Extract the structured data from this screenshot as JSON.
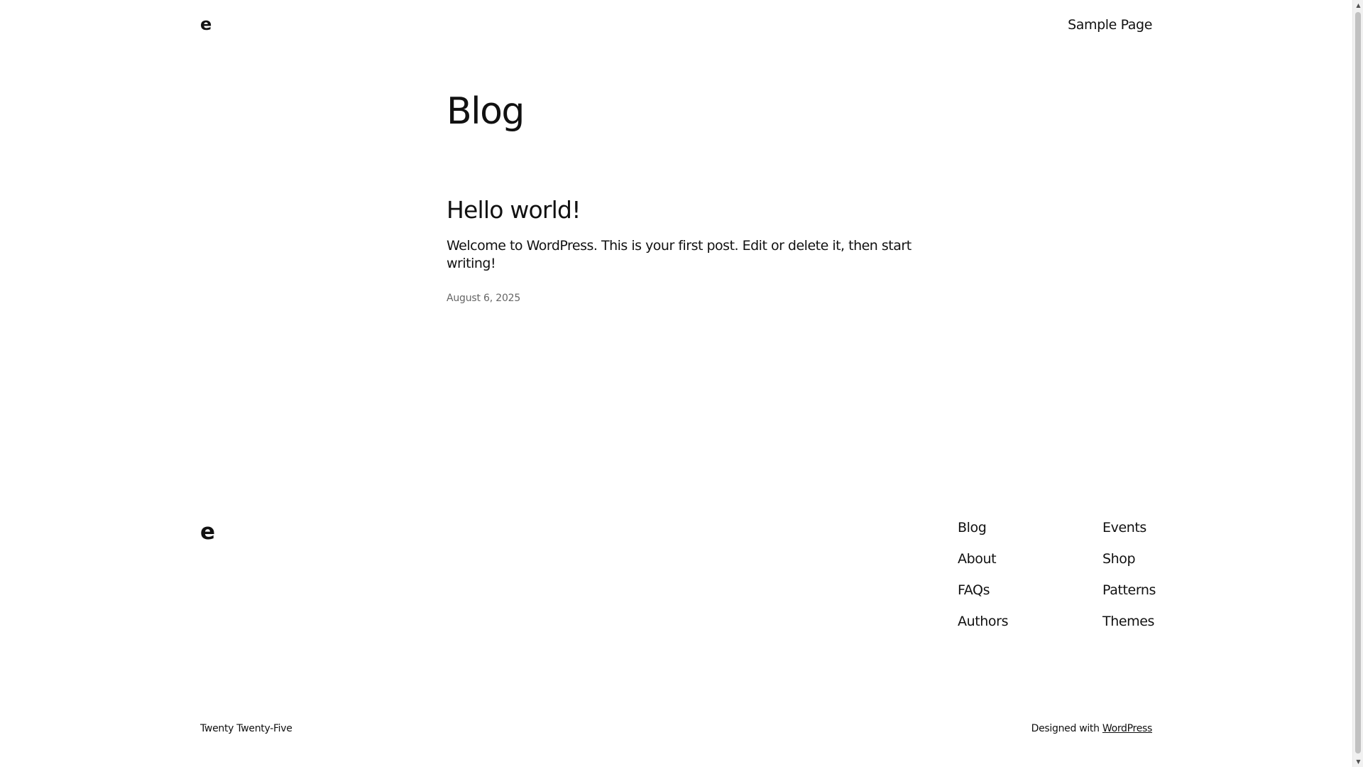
{
  "header": {
    "site_logo": "e",
    "nav_item": "Sample Page"
  },
  "main": {
    "page_title": "Blog",
    "posts": [
      {
        "title": "Hello world!",
        "excerpt": "Welcome to WordPress. This is your first post. Edit or delete it, then start writing!",
        "date": "August 6, 2025"
      }
    ]
  },
  "footer": {
    "site_logo": "e",
    "nav_col_1": [
      "Blog",
      "About",
      "FAQs",
      "Authors"
    ],
    "nav_col_2": [
      "Events",
      "Shop",
      "Patterns",
      "Themes"
    ],
    "theme_name": "Twenty Twenty-Five",
    "credit_prefix": "Designed with ",
    "credit_link": "WordPress"
  },
  "scrollbar": {
    "up_icon": "triangle-up",
    "down_icon": "triangle-down"
  },
  "colors": {
    "text": "#111111",
    "muted": "#666666",
    "background": "#ffffff"
  }
}
